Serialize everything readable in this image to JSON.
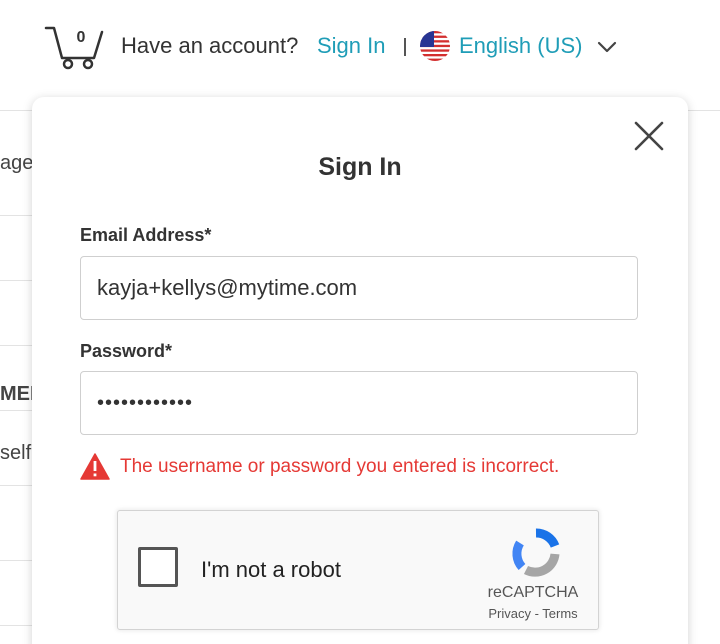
{
  "header": {
    "cart_count": "0",
    "have_account_text": "Have an account?",
    "sign_in_link": "Sign In",
    "language": "English (US)"
  },
  "background_list": {
    "rows": [
      "age",
      "",
      "",
      "MEI",
      "self",
      "",
      ""
    ]
  },
  "modal": {
    "title": "Sign In",
    "email_label": "Email Address*",
    "email_value": "kayja+kellys@mytime.com",
    "password_label": "Password*",
    "password_value": "••••••••••••",
    "error_message": "The username or password you entered is incorrect."
  },
  "recaptcha": {
    "label": "I'm not a robot",
    "brand": "reCAPTCHA",
    "privacy": "Privacy",
    "separator": " - ",
    "terms": "Terms"
  },
  "colors": {
    "link": "#1f9db7",
    "error": "#e53935",
    "text": "#333333"
  },
  "icons": {
    "cart": "cart-icon",
    "flag": "us-flag-icon",
    "chevron": "chevron-down-icon",
    "close": "close-icon",
    "warning": "warning-icon",
    "recaptcha": "recaptcha-logo-icon"
  }
}
